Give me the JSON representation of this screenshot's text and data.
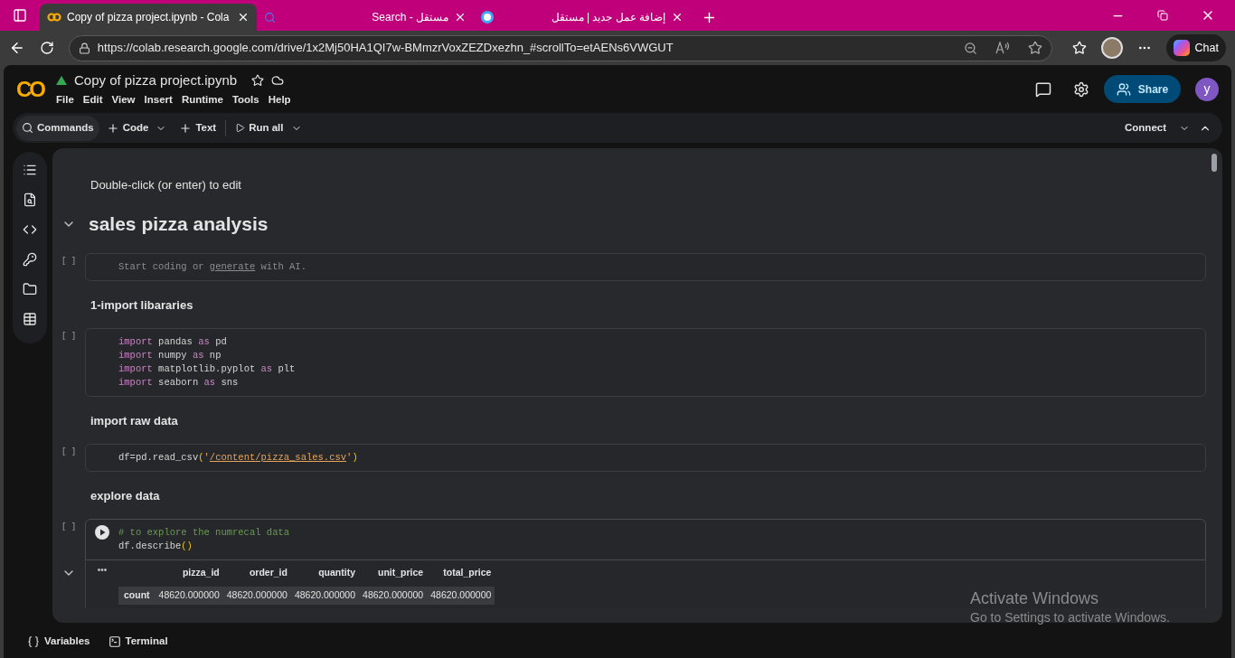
{
  "browser": {
    "tabs": [
      {
        "title": "Copy of pizza project.ipynb - Cola",
        "selected": true,
        "kind": "colab"
      },
      {
        "title": "Search - مستقل",
        "selected": false,
        "kind": "search"
      },
      {
        "title": "إضافة عمل جديد | مستقل",
        "selected": false,
        "kind": "ring"
      }
    ],
    "url": "https://colab.research.google.com/drive/1x2Mj50HA1QI7w-BMmzrVoxZEZDxezhn_#scrollTo=etAENs6VWGUT",
    "chat": "Chat"
  },
  "notebook": {
    "logo": "CO",
    "title": "Copy of pizza project.ipynb",
    "menu": [
      "File",
      "Edit",
      "View",
      "Insert",
      "Runtime",
      "Tools",
      "Help"
    ],
    "share": "Share",
    "avatar": "y"
  },
  "toolbar": {
    "commands": "Commands",
    "code": "Code",
    "text": "Text",
    "run_all": "Run all",
    "connect": "Connect"
  },
  "cells": [
    {
      "kind": "hint",
      "text": "Double-click (or enter) to edit"
    },
    {
      "kind": "title",
      "text": "sales pizza analysis"
    },
    {
      "kind": "code",
      "bracket": "[ ]",
      "focused": false,
      "placeholder": {
        "before": "Start coding or ",
        "link": "generate",
        "after": " with AI."
      }
    },
    {
      "kind": "heading",
      "text": "1-import libararies"
    },
    {
      "kind": "code",
      "bracket": "[ ]",
      "focused": false,
      "lines": [
        [
          {
            "text": "import",
            "kind": "keyword"
          },
          {
            "text": " pandas ",
            "kind": "plain"
          },
          {
            "text": "as",
            "kind": "keyword"
          },
          {
            "text": " pd",
            "kind": "plain"
          }
        ],
        [
          {
            "text": "import",
            "kind": "keyword"
          },
          {
            "text": " numpy ",
            "kind": "plain"
          },
          {
            "text": "as",
            "kind": "keyword"
          },
          {
            "text": " np",
            "kind": "plain"
          }
        ],
        [
          {
            "text": "import",
            "kind": "keyword"
          },
          {
            "text": " matplotlib.pyplot ",
            "kind": "plain"
          },
          {
            "text": "as",
            "kind": "keyword"
          },
          {
            "text": " plt",
            "kind": "plain"
          }
        ],
        [
          {
            "text": "import",
            "kind": "keyword"
          },
          {
            "text": " seaborn ",
            "kind": "plain"
          },
          {
            "text": "as",
            "kind": "keyword"
          },
          {
            "text": " sns",
            "kind": "plain"
          }
        ]
      ]
    },
    {
      "kind": "heading",
      "text": "import raw data"
    },
    {
      "kind": "code",
      "bracket": "[ ]",
      "focused": false,
      "lines": [
        [
          {
            "text": "df=pd.read_csv",
            "kind": "plain"
          },
          {
            "text": "(",
            "kind": "paren"
          },
          {
            "text": "'",
            "kind": "string"
          },
          {
            "text": "/content/pizza_sales.csv",
            "kind": "path"
          },
          {
            "text": "'",
            "kind": "string"
          },
          {
            "text": ")",
            "kind": "paren"
          }
        ]
      ]
    },
    {
      "kind": "heading",
      "text": "explore data"
    },
    {
      "kind": "code",
      "bracket": "[ ]",
      "focused": true,
      "lines": [
        [
          {
            "text": "# to explore the numrecal data",
            "kind": "comment"
          }
        ],
        [
          {
            "text": "df.describe",
            "kind": "plain"
          },
          {
            "text": "()",
            "kind": "paren"
          }
        ]
      ],
      "output": {
        "menu": "•••",
        "columns": [
          "pizza_id",
          "order_id",
          "quantity",
          "unit_price",
          "total_price"
        ],
        "rows": [
          {
            "label": "count",
            "values": [
              "48620.000000",
              "48620.000000",
              "48620.000000",
              "48620.000000",
              "48620.000000"
            ]
          }
        ]
      }
    }
  ],
  "bottom_bar": {
    "variables": "Variables",
    "terminal": "Terminal"
  },
  "activation": {
    "title": "Activate Windows",
    "text": "Go to Settings to activate Windows."
  }
}
